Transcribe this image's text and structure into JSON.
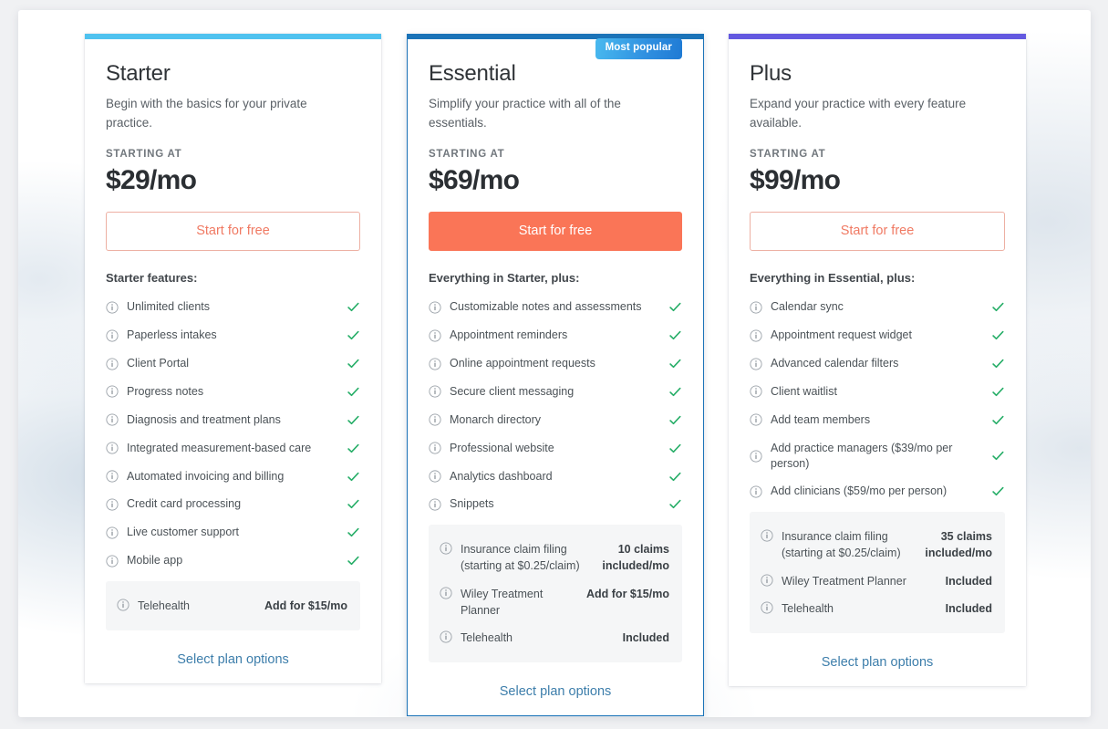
{
  "plans": [
    {
      "id": "starter",
      "accent_color": "#4fc2ef",
      "name": "Starter",
      "description": "Begin with the basics for your private practice.",
      "starting_at_label": "STARTING AT",
      "price": "$29/mo",
      "cta_label": "Start for free",
      "features_title": "Starter features:",
      "features": [
        "Unlimited clients",
        "Paperless intakes",
        "Client Portal",
        "Progress notes",
        "Diagnosis and treatment plans",
        "Integrated measurement-based care",
        "Automated invoicing and billing",
        "Credit card processing",
        "Live customer support",
        "Mobile app"
      ],
      "addons": [
        {
          "name": "Telehealth",
          "value": "Add for $15/mo"
        }
      ],
      "select_link_label": "Select plan options"
    },
    {
      "id": "essential",
      "accent_color": "#1a73b8",
      "badge": "Most popular",
      "name": "Essential",
      "description": "Simplify your practice with all of the essentials.",
      "starting_at_label": "STARTING AT",
      "price": "$69/mo",
      "cta_label": "Start for free",
      "features_title": "Everything in Starter, plus:",
      "features": [
        "Customizable notes and assessments",
        "Appointment reminders",
        "Online appointment requests",
        "Secure client messaging",
        "Monarch directory",
        "Professional website",
        "Analytics dashboard",
        "Snippets"
      ],
      "addons": [
        {
          "name": "Insurance claim filing\n(starting at $0.25/claim)",
          "value": "10 claims\nincluded/mo"
        },
        {
          "name": "Wiley Treatment Planner",
          "value": "Add for $15/mo"
        },
        {
          "name": "Telehealth",
          "value": "Included"
        }
      ],
      "select_link_label": "Select plan options"
    },
    {
      "id": "plus",
      "accent_color": "#6359e0",
      "name": "Plus",
      "description": "Expand your practice with every feature available.",
      "starting_at_label": "STARTING AT",
      "price": "$99/mo",
      "cta_label": "Start for free",
      "features_title": "Everything in Essential, plus:",
      "features": [
        "Calendar sync",
        "Appointment request widget",
        "Advanced calendar filters",
        "Client waitlist",
        "Add team members",
        "Add practice managers ($39/mo per person)",
        "Add clinicians ($59/mo per person)"
      ],
      "addons": [
        {
          "name": "Insurance claim filing\n(starting at $0.25/claim)",
          "value": "35 claims\nincluded/mo"
        },
        {
          "name": "Wiley Treatment Planner",
          "value": "Included"
        },
        {
          "name": "Telehealth",
          "value": "Included"
        }
      ],
      "select_link_label": "Select plan options"
    }
  ],
  "icons": {
    "info": "info-icon",
    "check": "check-icon"
  },
  "colors": {
    "cta_outline_text": "#f07a63",
    "cta_solid_bg": "#fa7557",
    "check_green": "#27ae68",
    "link_blue": "#3d7eab"
  }
}
